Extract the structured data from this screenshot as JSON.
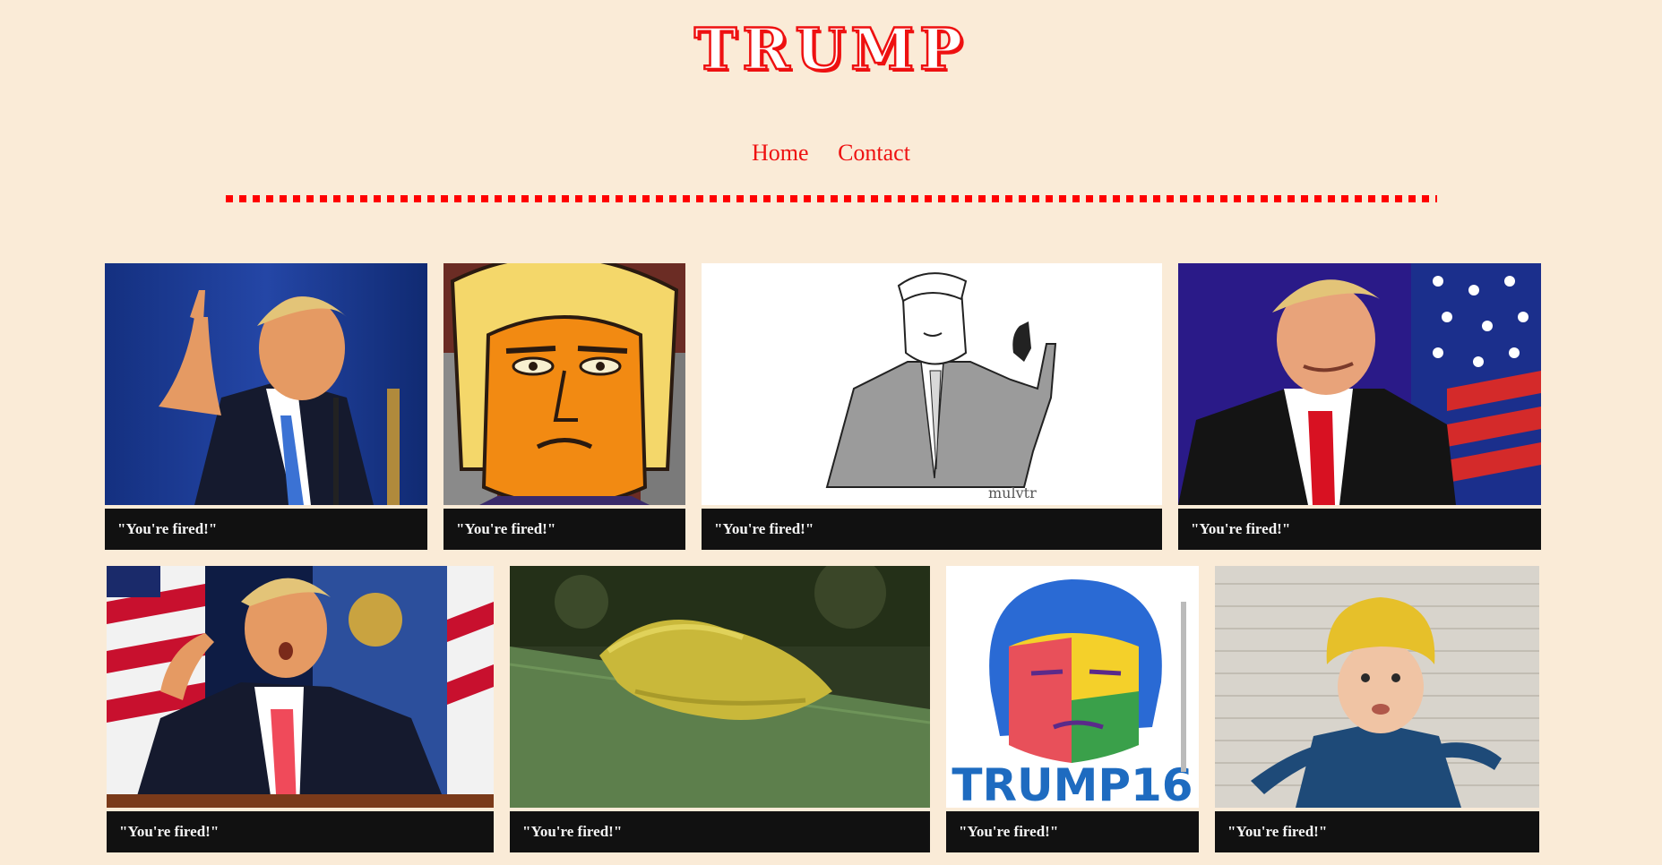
{
  "header": {
    "title": "TRUMP",
    "title_color": "#ee1111",
    "background_color": "#faebd7"
  },
  "nav": {
    "items": [
      {
        "label": "Home"
      },
      {
        "label": "Contact"
      }
    ]
  },
  "gallery": {
    "rows": [
      {
        "cards": [
          {
            "image": "trump-pointing-finger-photo",
            "caption": "\"You're fired!\""
          },
          {
            "image": "trump-cartoon-orange-face",
            "caption": "\"You're fired!\""
          },
          {
            "image": "trump-sketch-foam-finger",
            "caption": "\"You're fired!\""
          },
          {
            "image": "trump-smiling-flag-photo",
            "caption": "\"You're fired!\""
          }
        ]
      },
      {
        "cards": [
          {
            "image": "trump-surprised-podium-photo",
            "caption": "\"You're fired!\""
          },
          {
            "image": "yellow-hairy-caterpillar-photo",
            "caption": "\"You're fired!\""
          },
          {
            "image": "trump-pop-art-portrait",
            "caption": "\"You're fired!\"",
            "art_text": "TRUMP16"
          },
          {
            "image": "child-yellow-wig-photo",
            "caption": "\"You're fired!\""
          }
        ]
      }
    ]
  }
}
